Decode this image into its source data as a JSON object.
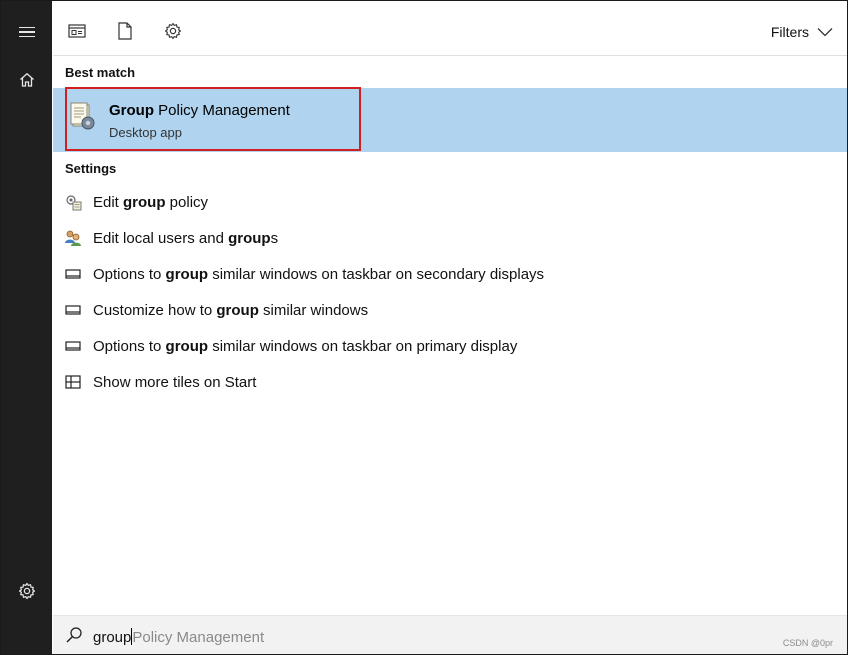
{
  "rail": {
    "menu_icon": "hamburger-icon",
    "home_icon": "home-icon",
    "settings_icon": "gear-icon"
  },
  "toolbar": {
    "icons": [
      "apps-icon",
      "document-icon",
      "gear-icon"
    ],
    "filters_label": "Filters"
  },
  "best_match": {
    "section_label": "Best match",
    "title_bold": "Group",
    "title_rest": " Policy Management",
    "subtitle": "Desktop app",
    "icon": "group-policy-icon",
    "highlight_color": "#d21f1f",
    "selected_bg": "#b0d4ef"
  },
  "settings": {
    "section_label": "Settings",
    "items": [
      {
        "icon": "policy-gear-icon",
        "pre": "Edit ",
        "bold": "group",
        "post": " policy"
      },
      {
        "icon": "users-icon",
        "pre": "Edit local users and ",
        "bold": "group",
        "post": "s"
      },
      {
        "icon": "display-icon",
        "pre": "Options to ",
        "bold": "group",
        "post": " similar windows on taskbar on secondary displays"
      },
      {
        "icon": "display-icon",
        "pre": "Customize how to ",
        "bold": "group",
        "post": " similar windows"
      },
      {
        "icon": "display-icon",
        "pre": "Options to ",
        "bold": "group",
        "post": " similar windows on taskbar on primary display"
      },
      {
        "icon": "tiles-icon",
        "pre": "Show more tiles on Start",
        "bold": "",
        "post": ""
      }
    ]
  },
  "search": {
    "icon": "search-icon",
    "typed": "group",
    "suggestion": "Policy Management",
    "watermark": "CSDN @0pr"
  }
}
